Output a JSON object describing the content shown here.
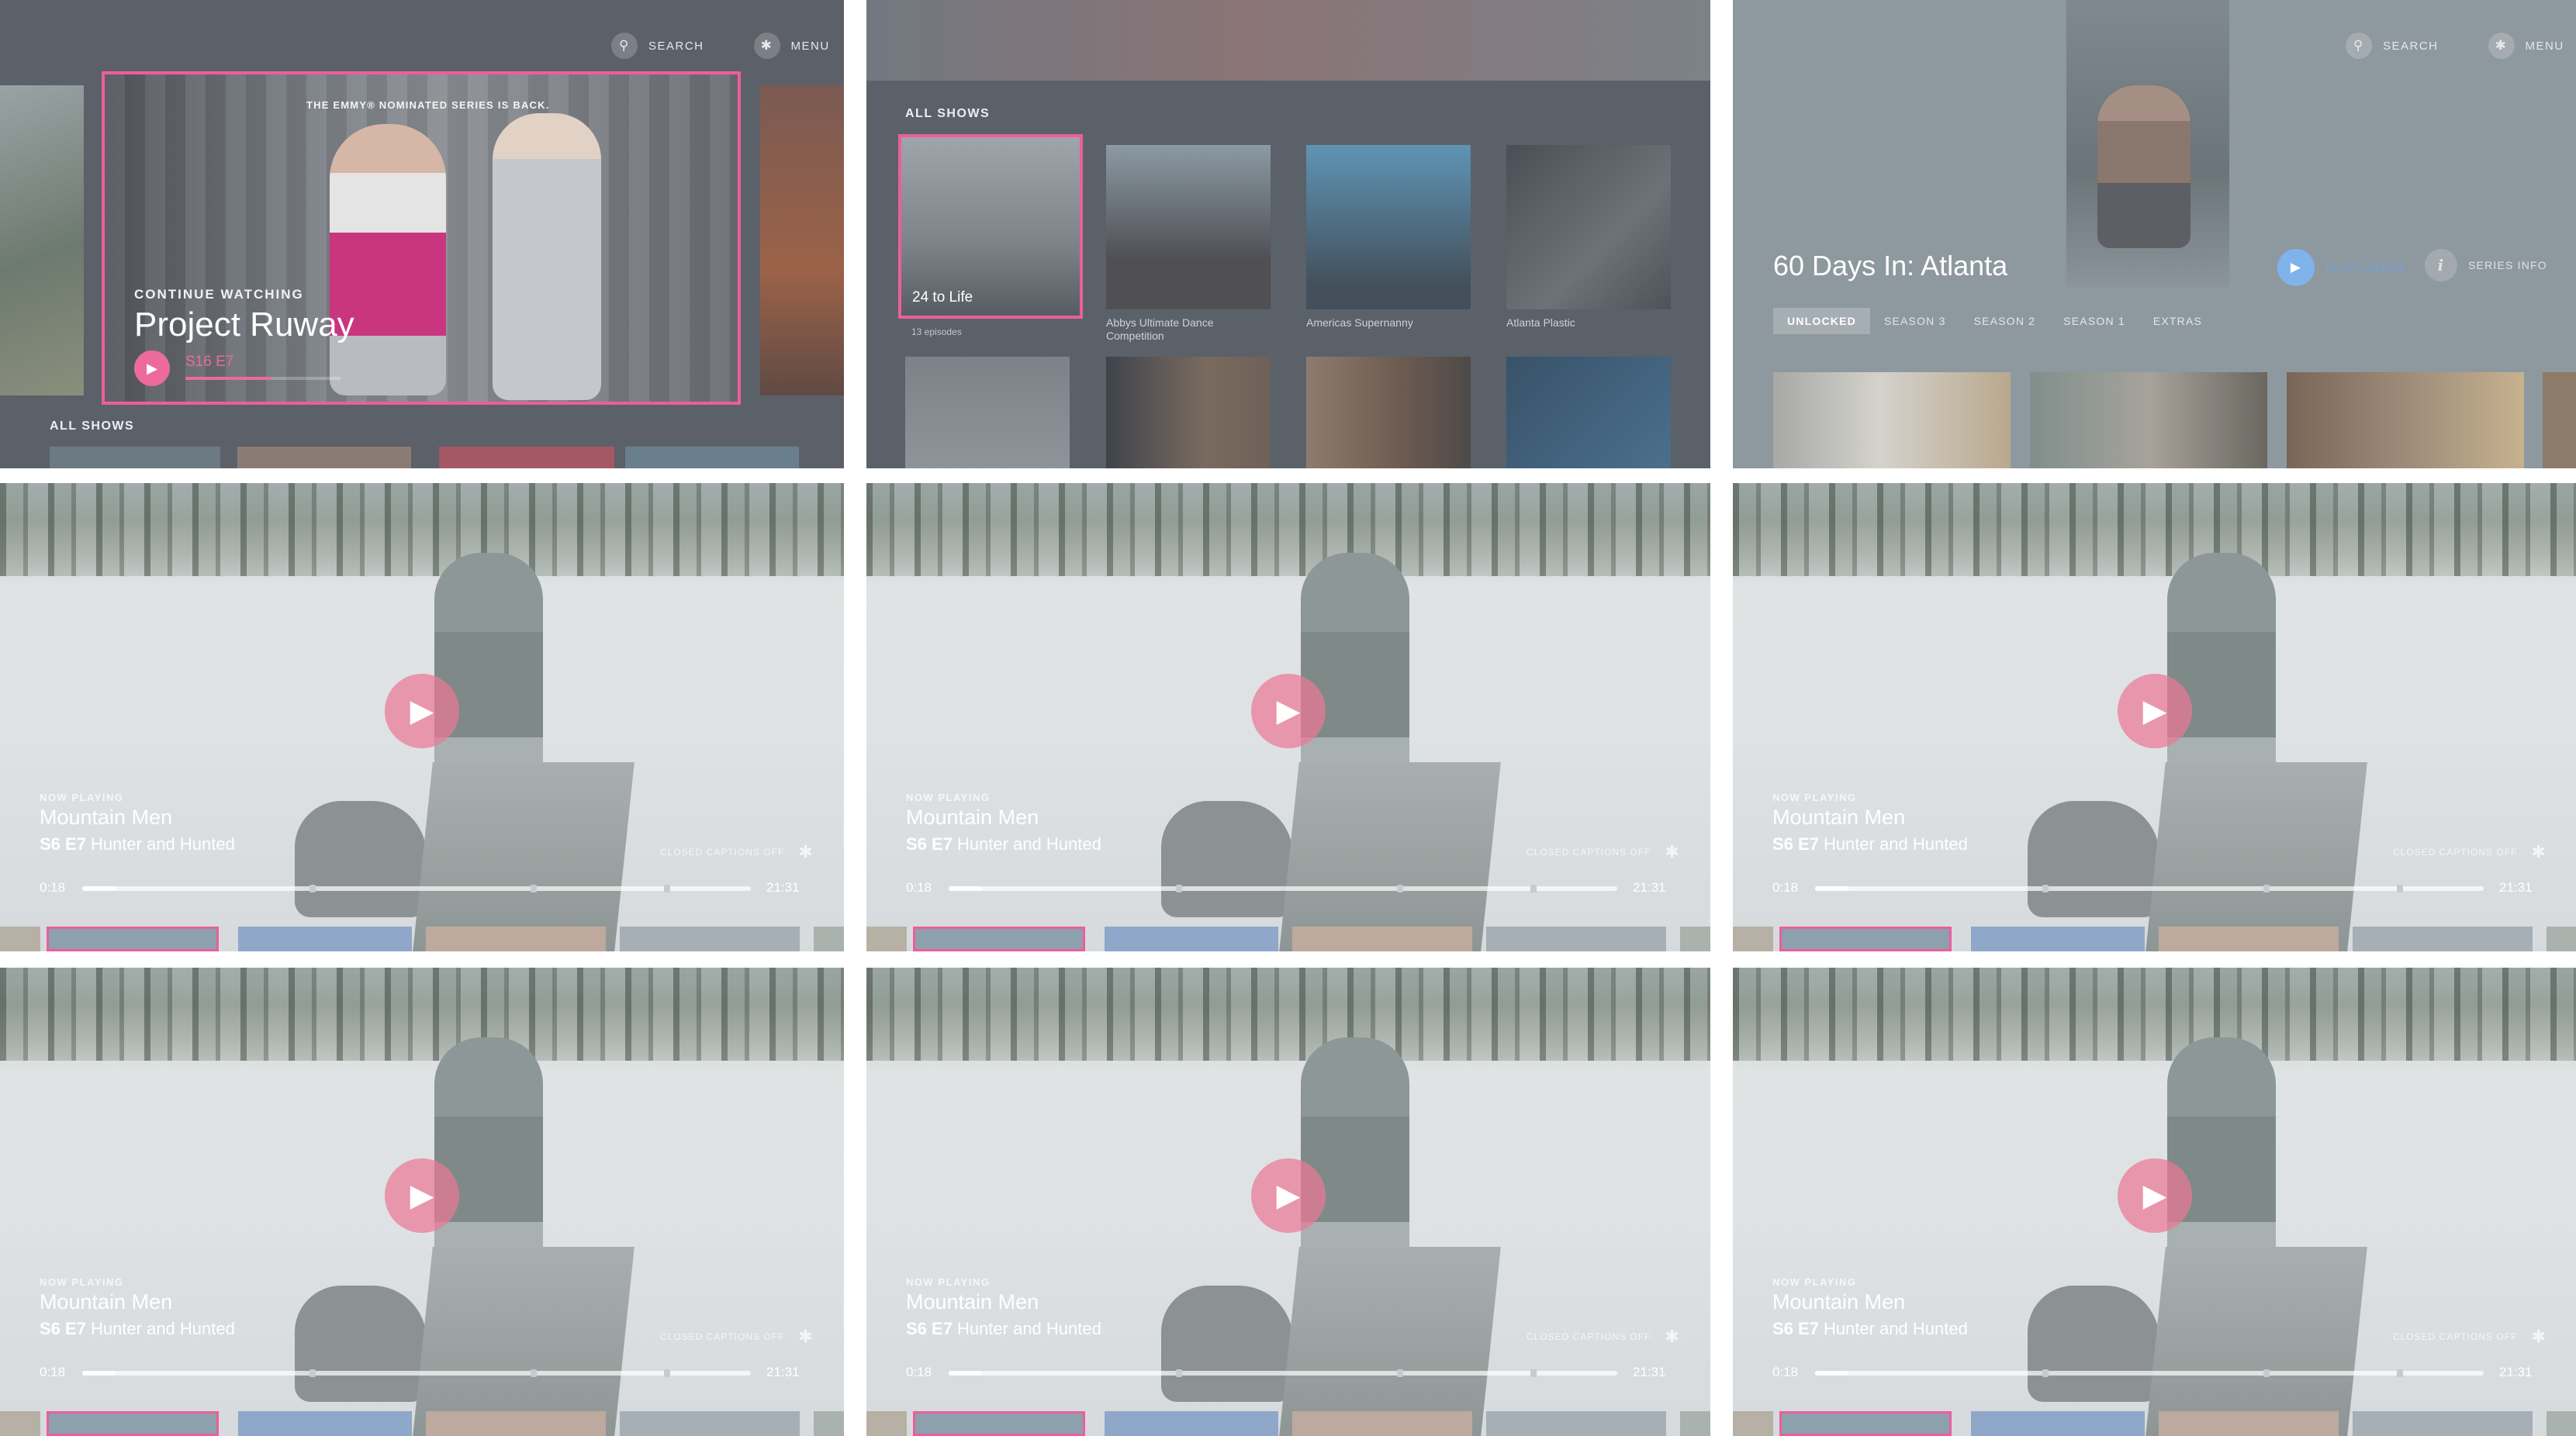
{
  "header": {
    "search_label": "SEARCH",
    "menu_label": "MENU"
  },
  "home": {
    "hero_tagline": "THE EMMY® NOMINATED SERIES IS BACK.",
    "continue_label": "CONTINUE WATCHING",
    "continue_title": "Project Ruway",
    "continue_episode": "S16 E7",
    "continue_progress": 0.55,
    "row_label": "ALL SHOWS"
  },
  "all_shows": {
    "row_label": "ALL SHOWS",
    "tiles": [
      {
        "title": "24 to Life",
        "meta": "13 episodes"
      },
      {
        "title": "Abbys Ultimate Dance Competition"
      },
      {
        "title": "Americas Supernanny"
      },
      {
        "title": "Atlanta Plastic"
      }
    ]
  },
  "series": {
    "title": "60 Days In: Atlanta",
    "play_latest": "PLAY LATEST",
    "series_info": "SERIES INFO",
    "tabs": [
      "UNLOCKED",
      "SEASON 3",
      "SEASON 2",
      "SEASON 1",
      "EXTRAS"
    ],
    "active_tab": "UNLOCKED"
  },
  "player": {
    "now_playing": "NOW PLAYING",
    "show": "Mountain Men",
    "episode_code": "S6 E7",
    "episode_title": "Hunter and Hunted",
    "closed_captions": "CLOSED CAPTIONS OFF",
    "elapsed": "0:18",
    "duration": "21:31",
    "progress": 0.05,
    "chapter_marks": [
      0.34,
      0.67,
      0.87
    ]
  },
  "colors": {
    "accent": "#ec5e9c",
    "play_blue": "#7fb3ea"
  }
}
